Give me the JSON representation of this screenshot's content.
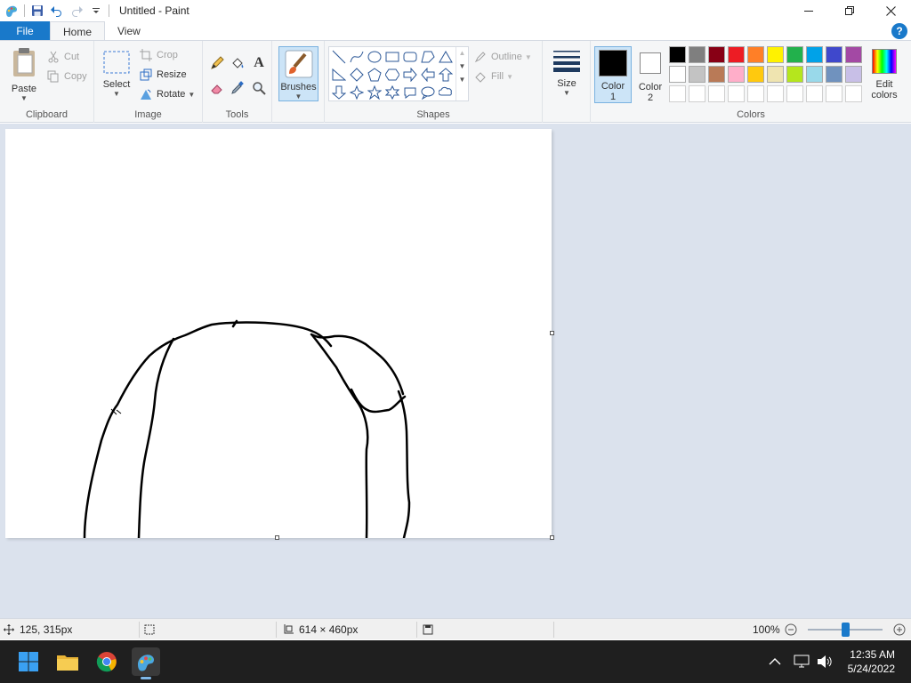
{
  "window": {
    "title": "Untitled - Paint"
  },
  "tabs": [
    {
      "label": "File"
    },
    {
      "label": "Home"
    },
    {
      "label": "View"
    }
  ],
  "clipboard": {
    "paste": "Paste",
    "cut": "Cut",
    "copy": "Copy",
    "label": "Clipboard"
  },
  "image": {
    "select": "Select",
    "crop": "Crop",
    "resize": "Resize",
    "rotate": "Rotate",
    "label": "Image"
  },
  "tools": {
    "label": "Tools",
    "items": [
      "pencil-icon",
      "fill-icon",
      "text-icon",
      "eraser-icon",
      "color-picker-icon",
      "magnifier-icon"
    ]
  },
  "brushes": {
    "label": "Brushes"
  },
  "shapes": {
    "label": "Shapes",
    "outline": "Outline",
    "fill": "Fill"
  },
  "size": {
    "label": "Size"
  },
  "colors": {
    "color1_line1": "Color",
    "color1_line2": "1",
    "color2_line1": "Color",
    "color2_line2": "2",
    "edit_line1": "Edit",
    "edit_line2": "colors",
    "label": "Colors",
    "color1_value": "#000000",
    "color2_value": "#ffffff",
    "palette_row1": [
      "#000000",
      "#7f7f7f",
      "#880015",
      "#ed1c24",
      "#ff7f27",
      "#fff200",
      "#22b14c",
      "#00a2e8",
      "#3f48cc",
      "#a349a4"
    ],
    "palette_row2": [
      "#ffffff",
      "#c3c3c3",
      "#b97a57",
      "#ffaec9",
      "#ffc90e",
      "#efe4b0",
      "#b5e61d",
      "#99d9ea",
      "#7092be",
      "#c8bfe7"
    ],
    "palette_row3": [
      "#ffffff",
      "#ffffff",
      "#ffffff",
      "#ffffff",
      "#ffffff",
      "#ffffff",
      "#ffffff",
      "#ffffff",
      "#ffffff",
      "#ffffff"
    ]
  },
  "status": {
    "cursor_pos": "125, 315px",
    "canvas_size": "614 × 460px",
    "zoom": "100%",
    "zoom_fraction": 0.5
  },
  "taskbar": {
    "time": "12:35 AM",
    "date": "5/24/2022"
  }
}
